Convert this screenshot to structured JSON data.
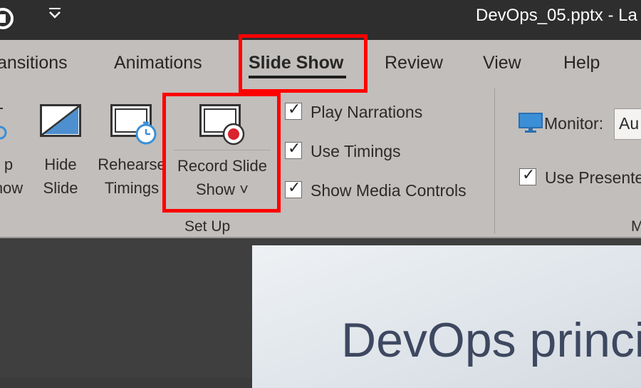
{
  "window": {
    "title": "DevOps_05.pptx  -  La"
  },
  "tabs": [
    {
      "label": "ansitions"
    },
    {
      "label": "Animations"
    },
    {
      "label": "Slide Show",
      "active": true
    },
    {
      "label": "Review"
    },
    {
      "label": "View"
    },
    {
      "label": "Help"
    }
  ],
  "ribbon": {
    "setup_button_label": "p\nhow",
    "hide_slide_label": "Hide\nSlide",
    "rehearse_label": "Rehearse\nTimings",
    "record_label": "Record Slide\nShow ˅",
    "checks": [
      {
        "label": "Play Narrations",
        "checked": true
      },
      {
        "label": "Use Timings",
        "checked": true
      },
      {
        "label": "Show Media Controls",
        "checked": true
      }
    ],
    "group_setup_label": "Set Up",
    "monitor_label": "Monitor:",
    "monitor_value": "Au",
    "presenter_view_label": "Use Presente",
    "group_monitors_label": "M"
  },
  "slide": {
    "title": "DevOps princip"
  },
  "colors": {
    "highlight": "#ff0000",
    "accent_icon": "#3a8fd6",
    "record_dot": "#d9232e"
  }
}
